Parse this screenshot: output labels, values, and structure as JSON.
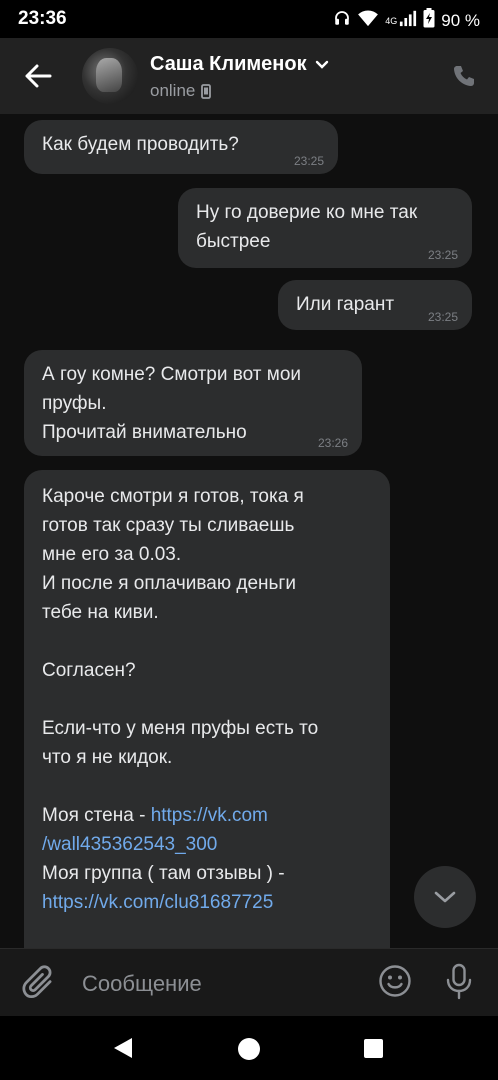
{
  "status_bar": {
    "time": "23:36",
    "network": "4G",
    "battery": "90 %"
  },
  "header": {
    "contact_name": "Саша Клименок",
    "status": "online"
  },
  "messages": [
    {
      "direction": "incoming",
      "text": "Как будем проводить?",
      "time": "23:25"
    },
    {
      "direction": "outgoing",
      "text": "Ну го доверие ко мне так\nбыстрее",
      "time": "23:25"
    },
    {
      "direction": "outgoing",
      "text": "Или гарант",
      "time": "23:25"
    },
    {
      "direction": "incoming",
      "text": "А гоу комне? Смотри вот мои\nпруфы.\nПрочитай внимательно",
      "time": "23:26"
    },
    {
      "direction": "incoming",
      "text": "Кароче смотри я готов, тока я\nготов так сразу ты сливаешь\nмне его за 0.03.\nИ после я оплачиваю деньги\nтебе на киви.\n\nСогласен?\n\nЕсли-что у меня пруфы есть то\nчто я не кидок.\n\n",
      "wall_label": "Моя стена - ",
      "wall_link_1": "https://vk.com",
      "wall_link_2": "/wall435362543_300",
      "group_label": "Моя группа ( там отзывы ) -",
      "group_link": "https://vk.com/clu81687725"
    }
  ],
  "composer": {
    "placeholder": "Сообщение"
  },
  "colors": {
    "bubble": "#2c2d2e",
    "link": "#71aaeb",
    "header": "#222222"
  }
}
